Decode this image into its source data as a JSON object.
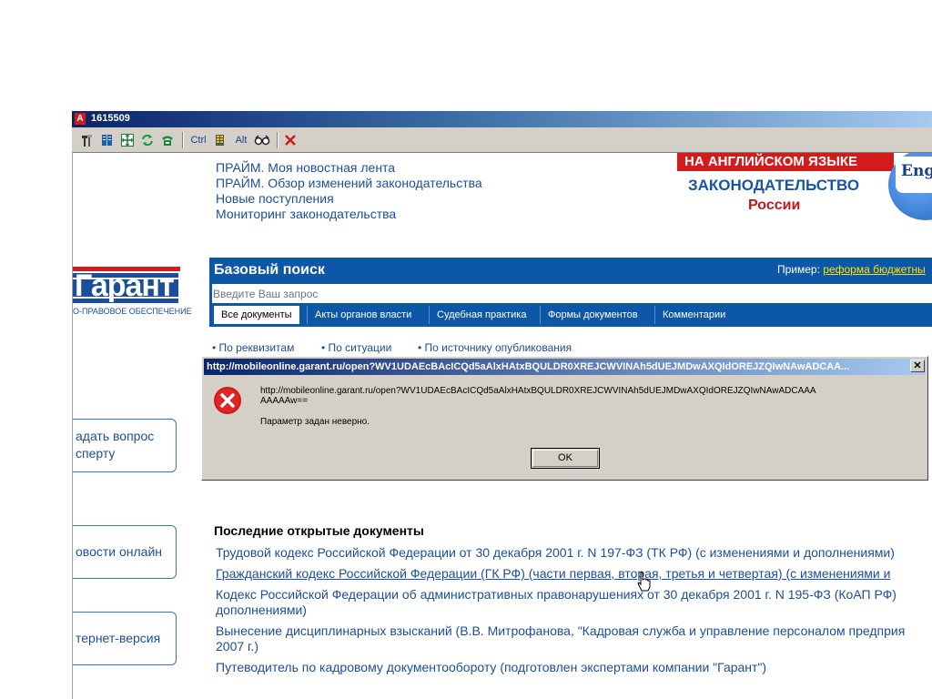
{
  "window": {
    "title": "1615509",
    "app_icon_letter": "A"
  },
  "toolbar": {
    "ctrl_label": "Ctrl",
    "alt_label": "Alt"
  },
  "top_links": [
    "ПРАЙМ. Моя новостная лента",
    "ПРАЙМ. Обзор изменений законодательства",
    "Новые поступления",
    "Мониторинг законодательства"
  ],
  "banner": {
    "line1": "НА АНГЛИЙСКОМ ЯЗЫКЕ",
    "line2": "ЗАКОНОДАТЕЛЬСТВО",
    "line3": "России",
    "globe_text": "Eng"
  },
  "logo": {
    "mark": "Гарант",
    "caption": "О-ПРАВОВОЕ ОБЕСПЕЧЕНИЕ"
  },
  "search": {
    "title": "Базовый поиск",
    "example_label": "Пример:",
    "example_link": "реформа бюджетны",
    "placeholder": "Введите Ваш запрос",
    "tabs": [
      "Все документы",
      "Акты органов власти",
      "Судебная практика",
      "Формы документов",
      "Комментарии"
    ],
    "sublinks": [
      "• По реквизитам",
      "• По ситуации",
      "• По источнику опубликования"
    ]
  },
  "left_boxes": {
    "ask_line1": "адать вопрос",
    "ask_line2": "сперту",
    "news": "овости онлайн",
    "internet": "тернет-версия"
  },
  "dialog": {
    "title": "http://mobileonline.garant.ru/open?WV1UDAEcBAcICQd5aAlxHAtxBQULDR0XREJCWVINAh5dUEJMDwAXQIdOREJZQIwNAwADCAA...",
    "close_label": "✕",
    "url_line1": "http://mobileonline.garant.ru/open?WV1UDAEcBAcICQd5aAlxHAtxBQULDR0XREJCWVINAh5dUEJMDwAXQIdOREJZQIwNAwADCAAA",
    "url_line2": "AAAAAw==",
    "message": "Параметр задан неверно.",
    "ok_label": "OK"
  },
  "recent": {
    "title": "Последние открытые документы",
    "docs": [
      "Трудовой кодекс Российской Федерации от 30 декабря 2001 г. N 197-ФЗ (ТК РФ) (с изменениями и дополнениями)",
      "Гражданский кодекс Российской Федерации (ГК РФ) (части первая, вторая, третья и четвертая) (с изменениями и",
      "Кодекс Российской Федерации об административных правонарушениях от 30 декабря 2001 г. N 195-ФЗ (КоАП РФ)",
      "дополнениями)",
      "Вынесение дисциплинарных взысканий (В.В. Митрофанова, \"Кадровая служба и управление персоналом предприя",
      "2007 г.)",
      "Путеводитель по кадровому документообороту (подготовлен экспертами компании \"Гарант\")"
    ]
  }
}
